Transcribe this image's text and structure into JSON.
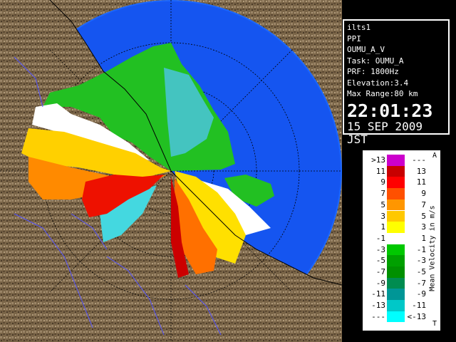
{
  "info": {
    "station": "ilts1",
    "mode": "PPI",
    "product": "OUMU_A_V",
    "task": "Task: OUMU_A",
    "prf": "PRF: 1800Hz",
    "elevation": "Elevation:3.4",
    "max_range": "Max Range:80 km",
    "time": "22:01:23",
    "date": "15 SEP 2009 JST"
  },
  "legend": {
    "title": "Mean Velocity in m/s",
    "top_marker": "A",
    "bottom_marker": "T",
    "rows": [
      {
        "left": ">13",
        "color": "#cc00cc",
        "right": "---"
      },
      {
        "left": "11",
        "color": "#c80000",
        "right": "13"
      },
      {
        "left": "9",
        "color": "#ff0000",
        "right": "11"
      },
      {
        "left": "7",
        "color": "#ff5000",
        "right": "9"
      },
      {
        "left": "5",
        "color": "#ff9600",
        "right": "7"
      },
      {
        "left": "3",
        "color": "#ffc800",
        "right": "5"
      },
      {
        "left": "1",
        "color": "#ffff00",
        "right": "3"
      },
      {
        "left": "-1",
        "color": "#ffffff",
        "right": "1"
      },
      {
        "left": "-3",
        "color": "#00c800",
        "right": "-1"
      },
      {
        "left": "-5",
        "color": "#00a000",
        "right": "-3"
      },
      {
        "left": "-7",
        "color": "#009000",
        "right": "-5"
      },
      {
        "left": "-9",
        "color": "#008c50",
        "right": "-7"
      },
      {
        "left": "-11",
        "color": "#009696",
        "right": "-9"
      },
      {
        "left": "-13",
        "color": "#00c8c8",
        "right": "-11"
      },
      {
        "left": "---",
        "color": "#00ffff",
        "right": "<-13"
      }
    ]
  },
  "colors": {
    "sea": "#1a66ff",
    "range_disk": "#0044dd",
    "land": "#8a7050",
    "echo_green": "#22cc22",
    "echo_cyan": "#44cccc",
    "echo_yellow": "#ffe000",
    "echo_orange": "#ff8800",
    "echo_red": "#ee1100",
    "echo_white": "#ffffff"
  }
}
